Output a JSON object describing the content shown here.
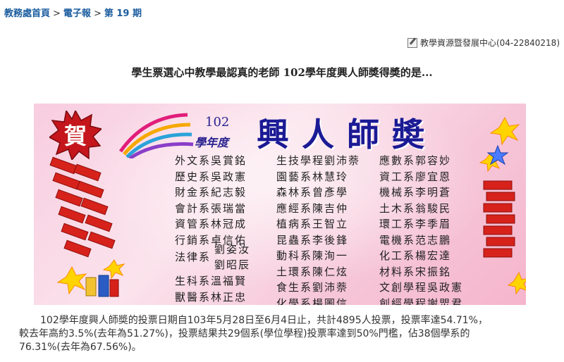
{
  "breadcrumb": {
    "home": "教務處首頁",
    "section": "電子報",
    "issue": "第 19 期",
    "separator": ">"
  },
  "contact": {
    "label": "教學資源暨發展中心(04-22840218)"
  },
  "headline": "學生票選心中教學最認真的老師 102學年度興人師奬得奬的是...",
  "banner": {
    "seal_char": "賀",
    "year_number": "102",
    "year_label": "學年度",
    "title": "興人師奬",
    "column1": [
      "外文系吳賞銘",
      "歷史系吳政憲",
      "財金系紀志毅",
      "會計系張瑞當",
      "資管系林冠成",
      "行銷系卓信佑"
    ],
    "law_dept": "法律系",
    "law_names": [
      "劉姿汝",
      "劉昭辰"
    ],
    "column1_tail": [
      "生科系溫福賢",
      "獸醫系林正忠"
    ],
    "column2": [
      "生技學程劉沛萘",
      "園藝系林慧玲",
      "森林系曾彥學",
      "應經系陳吉仲",
      "植病系王智立",
      "昆蟲系李後鋒",
      "動科系陳洵一",
      "土環系陳仁炫",
      "食生系劉沛萘",
      "化學系楊圖信"
    ],
    "column3": [
      "應數系郭容妙",
      "資工系廖宜恩",
      "機械系李明蒼",
      "土木系翁駿民",
      "環工系李季眉",
      "電機系范志鵬",
      "化工系楊宏達",
      "材料系宋振銘",
      "文創學程吳政憲",
      "創經學程謝焸君"
    ]
  },
  "body": {
    "line1": "102學年度興人師奬的投票日期自103年5月28日至6月4日止，共計4895人投票，投票率達54.71%，",
    "line2": "較去年高約3.5%(去年為51.27%)，投票結果共29個系(學位學程)投票率達到50%門檻，佔38個學系的",
    "line3": "76.31%(去年為67.56%)。"
  },
  "colors": {
    "link": "#1a5c9e",
    "title_blue": "#1b1a95",
    "banner_pink": "#f8cde0",
    "firecracker_red": "#d6221b"
  }
}
